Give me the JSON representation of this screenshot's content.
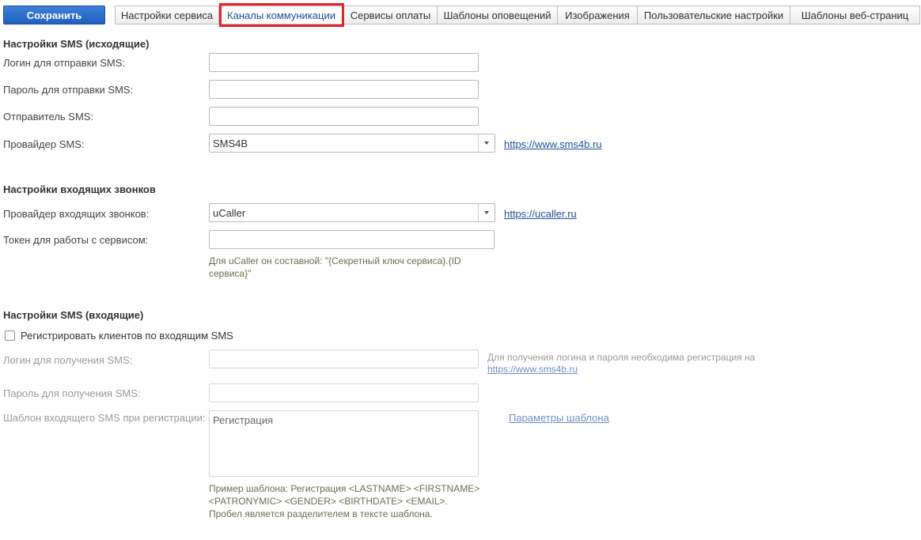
{
  "toolbar": {
    "save_label": "Сохранить",
    "tabs": [
      {
        "label": "Настройки сервиса"
      },
      {
        "label": "Каналы коммуникации"
      },
      {
        "label": "Сервисы оплаты"
      },
      {
        "label": "Шаблоны оповещений"
      },
      {
        "label": "Изображения"
      },
      {
        "label": "Пользовательские настройки"
      },
      {
        "label": "Шаблоны веб-страниц"
      }
    ],
    "active_tab": "Каналы коммуникации"
  },
  "sms_outgoing": {
    "title": "Настройки SMS (исходящие)",
    "login_label": "Логин для отправки SMS:",
    "login_value": "",
    "password_label": "Пароль для отправки SMS:",
    "password_value": "",
    "sender_label": "Отправитель SMS:",
    "sender_value": "",
    "provider_label": "Провайдер SMS:",
    "provider_value": "SMS4B",
    "provider_link": "https://www.sms4b.ru"
  },
  "incoming_calls": {
    "title": "Настройки входящих звонков",
    "provider_label": "Провайдер входящих звонков:",
    "provider_value": "uCaller",
    "provider_link": "https://ucaller.ru",
    "token_label": "Токен для работы с сервисом:",
    "token_value": "",
    "token_hint": "Для uCaller он составной: \"{Секретный ключ сервиса}.{ID сервиса}\""
  },
  "sms_incoming": {
    "title": "Настройки SMS (входящие)",
    "register_checkbox_label": "Регистрировать клиентов по входящим SMS",
    "register_checked": false,
    "login_label": "Логин для получения SMS:",
    "login_value": "",
    "login_hint": "Для получения логина и пароля необходима регистрация на",
    "login_hint_link": "https://www.sms4b.ru",
    "password_label": "Пароль для получения SMS:",
    "password_value": "",
    "template_label": "Шаблон входящего SMS при регистрации:",
    "template_value": "Регистрация",
    "template_params_link": "Параметры шаблона",
    "template_hint_1": "Пример шаблона: Регистрация <LASTNAME> <FIRSTNAME> <PATRONYMIC> <GENDER> <BIRTHDATE> <EMAIL>.",
    "template_hint_2": "Пробел является разделителем в тексте шаблона."
  },
  "colors": {
    "accent": "#1f5fbf",
    "highlight": "#e8202a",
    "link": "#1c4f96",
    "hint": "#6f6b4e"
  }
}
